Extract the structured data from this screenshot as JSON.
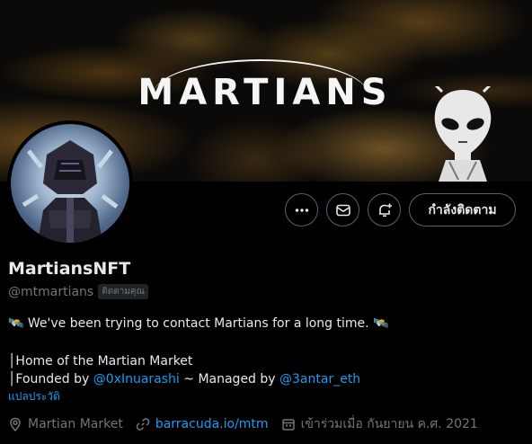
{
  "banner": {
    "logo_text": "MARTIANS"
  },
  "actions": {
    "more_icon": "more-icon",
    "message_icon": "mail-icon",
    "notify_icon": "bell-plus-icon",
    "follow_label": "กำลังติดตาม"
  },
  "profile": {
    "display_name": "MartiansNFT",
    "handle": "@mtmartians",
    "follows_you": "ติดตามคุณ"
  },
  "bio": {
    "line1": "🛰️ We've been trying to contact Martians for a long time. 🛰️",
    "line2": "│Home of the Martian Market",
    "line3_prefix": "│Founded by ",
    "line3_link1": "@0xInuarashi",
    "line3_middle": " ~ Managed by ",
    "line3_link2": "@3antar_eth",
    "translate": "แปลประวัติ"
  },
  "meta": {
    "location": "Martian Market",
    "website": "barracuda.io/mtm",
    "joined": "เข้าร่วมเมื่อ กันยายน ค.ศ. 2021"
  },
  "colors": {
    "accent": "#1d9bf0",
    "muted": "#71767b",
    "border": "#536471"
  }
}
